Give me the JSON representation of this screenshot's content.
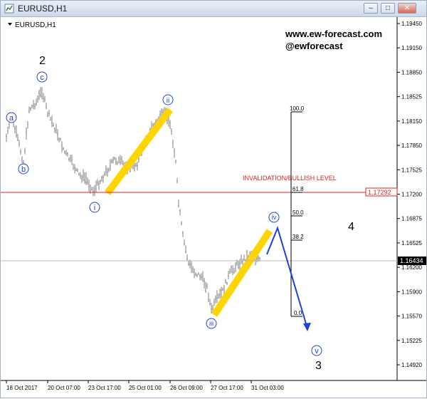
{
  "window": {
    "title": "EURUSD,H1",
    "buttons": [
      "minimize",
      "restore",
      "close"
    ]
  },
  "chart": {
    "symbol_label": "EURUSD,H1",
    "watermark_lines": [
      "www.ew-forecast.com",
      "@ewforecast"
    ],
    "colors": {
      "bars": "#808080",
      "wave_labels": "#1f3fd6",
      "invalidation": "#e02020",
      "channel": "#ffd400",
      "projection": "#1f3fd6",
      "price_tag": "#e02020",
      "current_tag": "#000000"
    },
    "price_axis": [
      "1.19450",
      "1.19150",
      "1.18850",
      "1.18525",
      "1.18150",
      "1.17850",
      "1.17525",
      "1.17200",
      "1.16875",
      "1.16525",
      "1.16200",
      "1.15900",
      "1.15570",
      "1.15225",
      "1.14920"
    ],
    "time_axis": [
      "18 Oct 2017",
      "20 Oct 07:00",
      "23 Oct 17:00",
      "25 Oct 01:00",
      "26 Oct 09:00",
      "27 Oct 17:00",
      "31 Oct 03:00"
    ],
    "invalidation_label": "INVALIDATION/BULLISH LEVEL",
    "invalidation_price": "1.17292",
    "current_price": "1.16434",
    "fib_levels": [
      "100.0",
      "61.8",
      "50.0",
      "38.2",
      "0.0"
    ],
    "degree_labels": [
      "2",
      "4",
      "3"
    ],
    "wave_labels": [
      "a",
      "b",
      "c",
      "i",
      "ii",
      "iii",
      "iv",
      "v"
    ]
  }
}
